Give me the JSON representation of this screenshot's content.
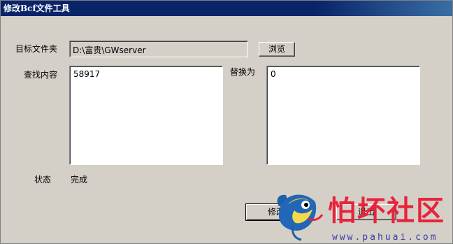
{
  "window": {
    "title": "修改Bcf文件工具"
  },
  "target_folder": {
    "label": "目标文件夹",
    "value": "D:\\富贵\\GWserver",
    "browse_label": "浏览"
  },
  "find": {
    "label": "查找内容",
    "value": "58917"
  },
  "replace": {
    "label": "替换为",
    "value": "0"
  },
  "status": {
    "label": "状态",
    "value": "完成"
  },
  "actions": {
    "modify_label": "修改",
    "exit_label": "退出"
  },
  "watermark": {
    "text": "怕坏社区",
    "url": "www.pahuai.com"
  },
  "colors": {
    "titlebar": "#0a246a",
    "face": "#d4d0c8",
    "watermark_red": "#e8233a"
  }
}
